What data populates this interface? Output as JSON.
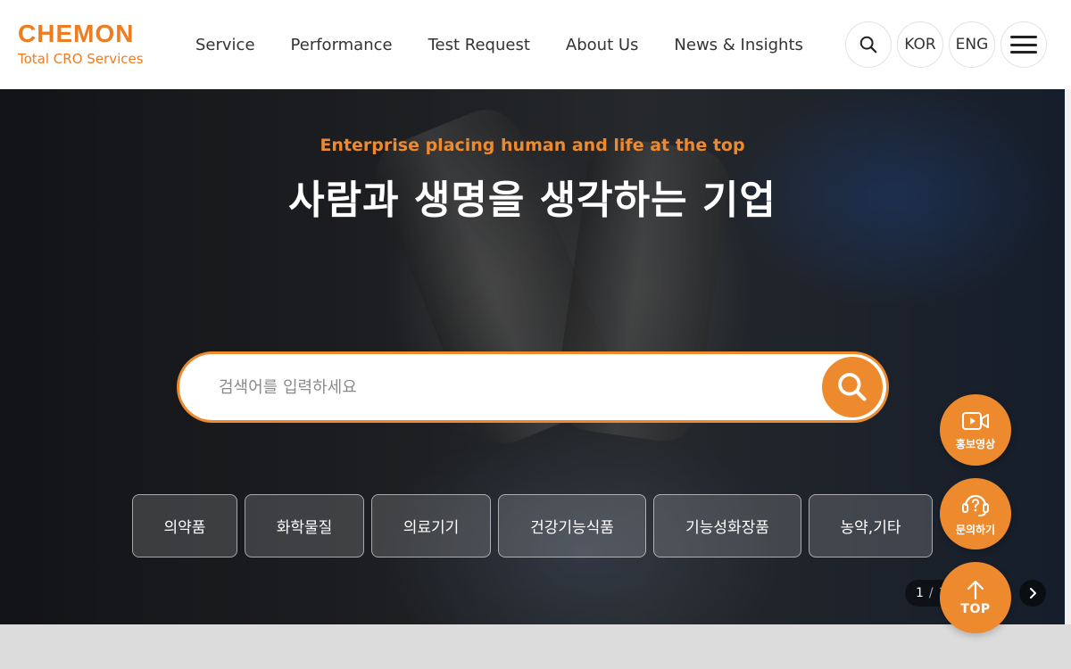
{
  "header": {
    "logo_main": "CHEMON",
    "logo_sub": "Total CRO Services",
    "nav": [
      {
        "label": "Service"
      },
      {
        "label": "Performance"
      },
      {
        "label": "Test Request"
      },
      {
        "label": "About Us"
      },
      {
        "label": "News & Insights"
      }
    ],
    "lang_kor": "KOR",
    "lang_eng": "ENG"
  },
  "hero": {
    "eyebrow": "Enterprise placing human and life at the top",
    "title": "사람과 생명을 생각하는 기업",
    "search_placeholder": "검색어를 입력하세요",
    "categories": [
      {
        "label": "의약품"
      },
      {
        "label": "화학물질"
      },
      {
        "label": "의료기기"
      },
      {
        "label": "건강기능식품"
      },
      {
        "label": "기능성화장품"
      },
      {
        "label": "농약,기타"
      }
    ],
    "pager": {
      "current": "1",
      "separator": "/",
      "total": "1"
    }
  },
  "floating": {
    "video_label": "홍보영상",
    "inquiry_label": "문의하기",
    "top_label": "TOP"
  },
  "colors": {
    "accent": "#ee8a2e",
    "brand": "#ee7d22"
  }
}
